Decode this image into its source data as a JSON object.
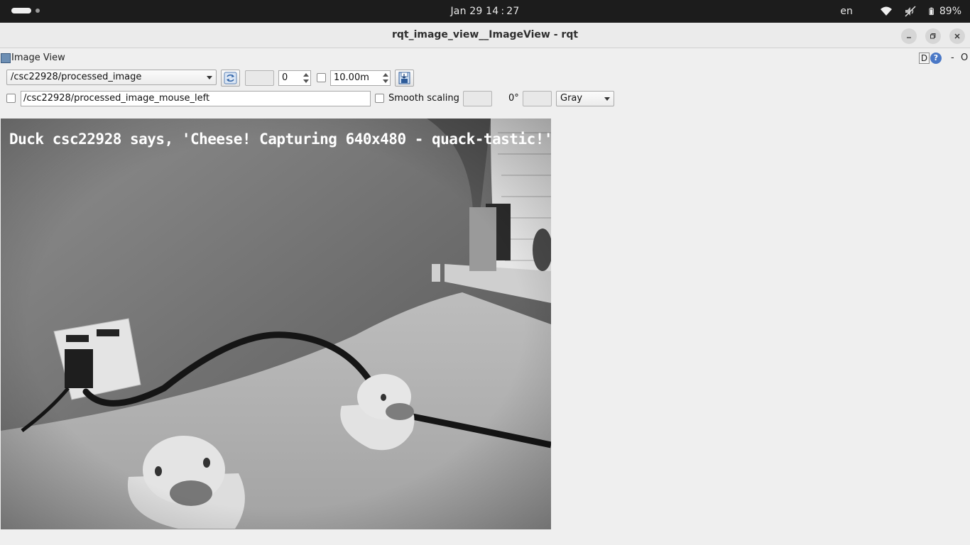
{
  "topbar": {
    "clock": "Jan 29  14 : 27",
    "language": "en",
    "battery": "89%",
    "icons": [
      "wifi-icon",
      "volume-muted-icon",
      "battery-icon"
    ]
  },
  "window": {
    "title": "rqt_image_view__ImageView - rqt",
    "controls": [
      "minimize-icon",
      "maximize-icon",
      "close-icon"
    ]
  },
  "dock": {
    "title": "Image View",
    "d_label": "D",
    "help_label": "?",
    "min_label": "-",
    "close_label": "O"
  },
  "toolbar": {
    "topic": "/csc22928/processed_image",
    "spin_value": "0",
    "rate_value": "10.00m",
    "mouse_topic": "/csc22928/processed_image_mouse_left",
    "smooth_label": "Smooth scaling",
    "rotation": "0°",
    "colormap": "Gray"
  },
  "image": {
    "overlay_text": "Duck csc22928 says, 'Cheese! Capturing 640x480 - quack-tastic!'"
  }
}
